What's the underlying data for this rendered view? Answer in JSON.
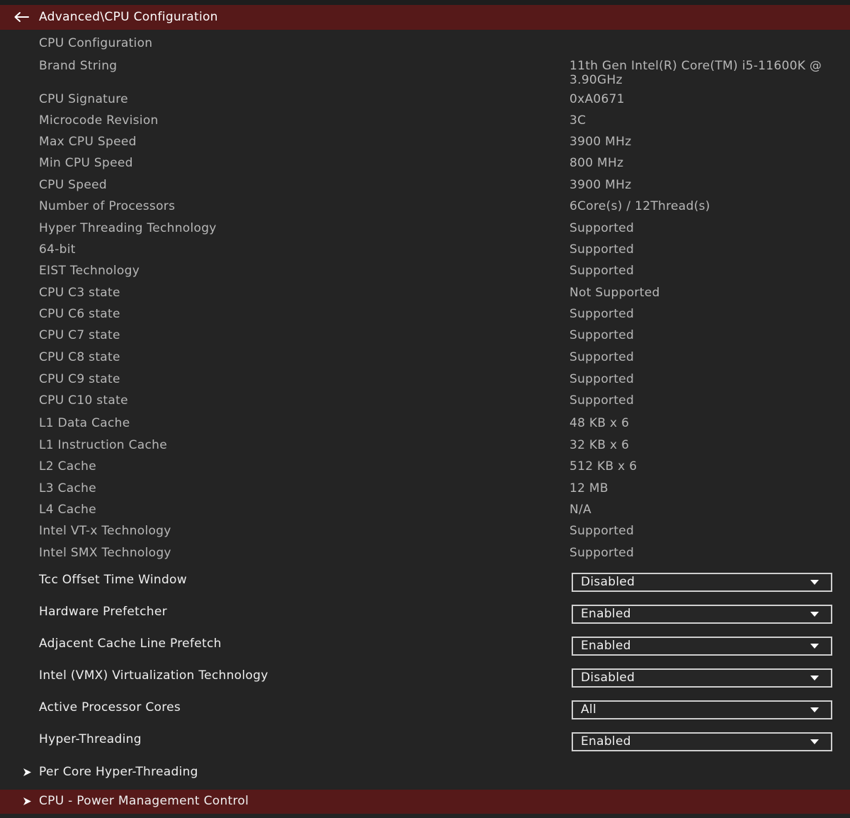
{
  "header": {
    "title": "Advanced\\CPU Configuration",
    "back_icon": "arrow-left-icon"
  },
  "section_title": "CPU Configuration",
  "info_rows": [
    {
      "label": "Brand String",
      "value": "11th Gen Intel(R) Core(TM) i5-11600K @ 3.90GHz"
    },
    {
      "label": "CPU Signature",
      "value": "0xA0671"
    },
    {
      "label": "Microcode Revision",
      "value": "3C"
    },
    {
      "label": "Max CPU Speed",
      "value": "3900 MHz"
    },
    {
      "label": "Min CPU Speed",
      "value": "800 MHz"
    },
    {
      "label": "CPU Speed",
      "value": "3900 MHz"
    },
    {
      "label": "Number of Processors",
      "value": "6Core(s) / 12Thread(s)"
    },
    {
      "label": "Hyper Threading Technology",
      "value": "Supported"
    },
    {
      "label": "64-bit",
      "value": "Supported"
    },
    {
      "label": "EIST Technology",
      "value": "Supported"
    },
    {
      "label": "CPU C3 state",
      "value": "Not Supported"
    },
    {
      "label": "CPU C6 state",
      "value": "Supported"
    },
    {
      "label": "CPU C7 state",
      "value": "Supported"
    },
    {
      "label": "CPU C8 state",
      "value": "Supported"
    },
    {
      "label": "CPU C9 state",
      "value": "Supported"
    },
    {
      "label": "CPU C10 state",
      "value": "Supported"
    },
    {
      "label": "L1 Data Cache",
      "value": "48 KB x 6"
    },
    {
      "label": "L1 Instruction Cache",
      "value": "32 KB x 6"
    },
    {
      "label": "L2 Cache",
      "value": "512 KB x 6"
    },
    {
      "label": "L3 Cache",
      "value": "12 MB"
    },
    {
      "label": "L4 Cache",
      "value": "N/A"
    },
    {
      "label": "Intel VT-x Technology",
      "value": "Supported"
    },
    {
      "label": "Intel SMX Technology",
      "value": "Supported"
    }
  ],
  "settings": [
    {
      "label": "Tcc Offset Time Window",
      "value": "Disabled"
    },
    {
      "label": "Hardware Prefetcher",
      "value": "Enabled"
    },
    {
      "label": "Adjacent Cache Line Prefetch",
      "value": "Enabled"
    },
    {
      "label": "Intel (VMX) Virtualization Technology",
      "value": "Disabled"
    },
    {
      "label": "Active Processor Cores",
      "value": "All"
    },
    {
      "label": "Hyper-Threading",
      "value": "Enabled"
    }
  ],
  "submenus": [
    {
      "label": "Per Core Hyper-Threading",
      "active": false
    },
    {
      "label": "CPU - Power Management Control",
      "active": true
    }
  ],
  "colors": {
    "accent": "#561919",
    "background": "#242424",
    "info_text": "#b8b8b8",
    "setting_text": "#efefef"
  }
}
